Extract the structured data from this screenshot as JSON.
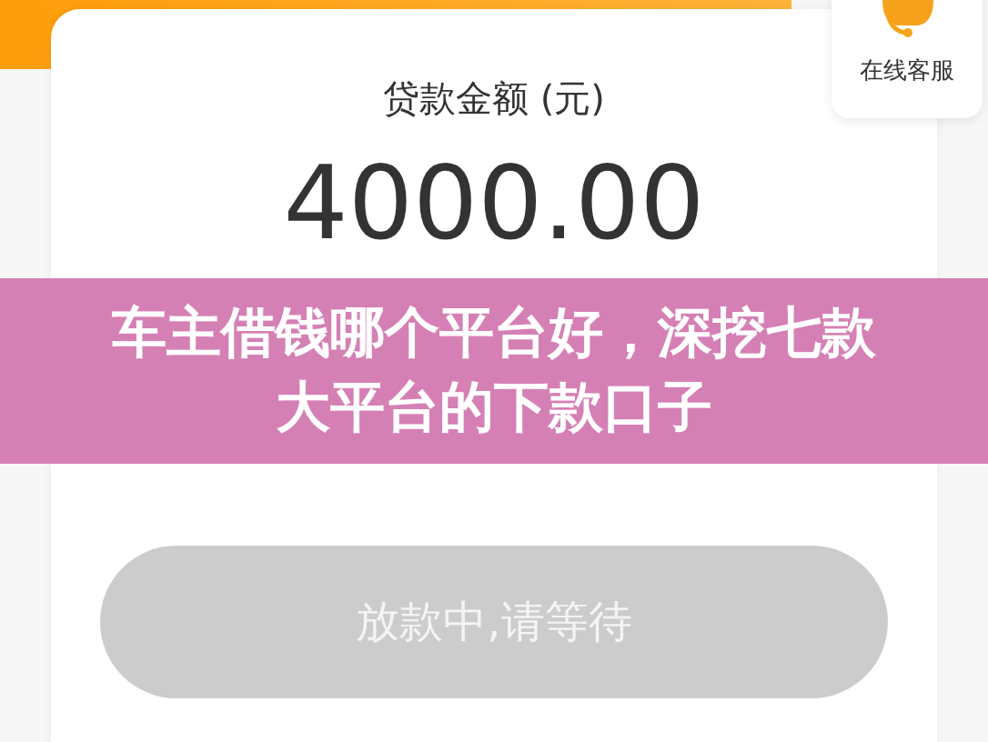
{
  "customer_service": {
    "label": "在线客服"
  },
  "loan": {
    "label": "贷款金额 (元)",
    "amount": "4000.00"
  },
  "banner": {
    "title": "车主借钱哪个平台好，深挖七款大平台的下款口子"
  },
  "action_button": {
    "label": "放款中,请等待",
    "disabled": true
  }
}
